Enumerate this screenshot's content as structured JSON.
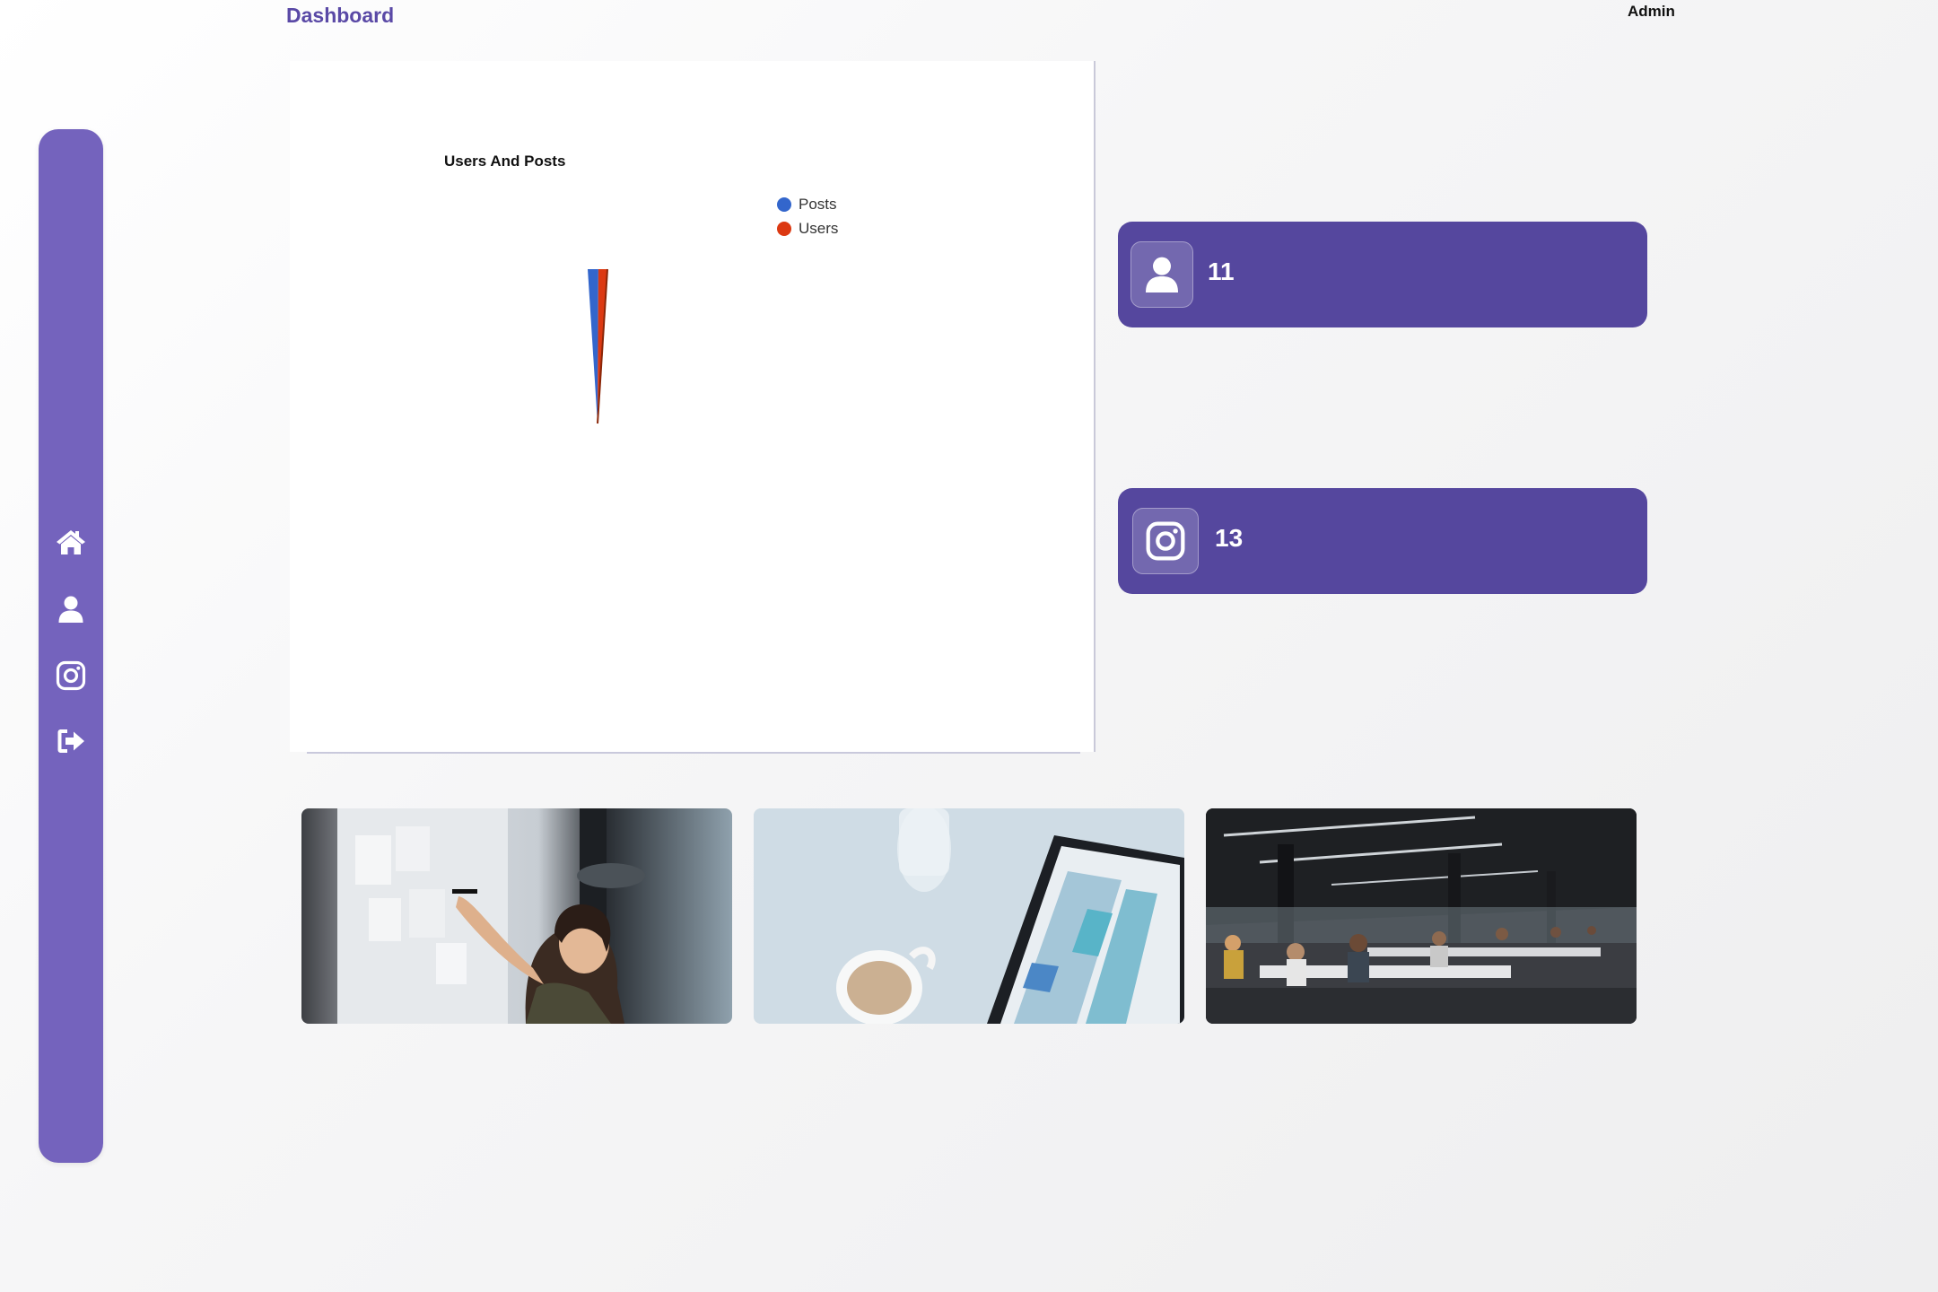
{
  "header": {
    "title": "Dashboard",
    "user": "Admin"
  },
  "sidebar": {
    "items": [
      {
        "icon": "home-icon"
      },
      {
        "icon": "user-icon"
      },
      {
        "icon": "instagram-icon"
      },
      {
        "icon": "logout-icon"
      }
    ]
  },
  "chart_data": {
    "type": "pie",
    "title": "Users And Posts",
    "categories": [
      "Posts",
      "Users"
    ],
    "values": [
      13,
      11
    ],
    "colors": [
      "#3366cc",
      "#dc3912"
    ],
    "legend": "top-right"
  },
  "stats": [
    {
      "icon": "user-icon",
      "value": "11"
    },
    {
      "icon": "instagram-icon",
      "value": "13"
    }
  ],
  "photos": [
    {
      "icon": "photo-woman-whiteboard"
    },
    {
      "icon": "photo-coffee-tablet"
    },
    {
      "icon": "photo-open-office"
    }
  ],
  "colors": {
    "accent": "#5a49a6",
    "sidebar": "#7463bd",
    "card": "#55479e"
  }
}
